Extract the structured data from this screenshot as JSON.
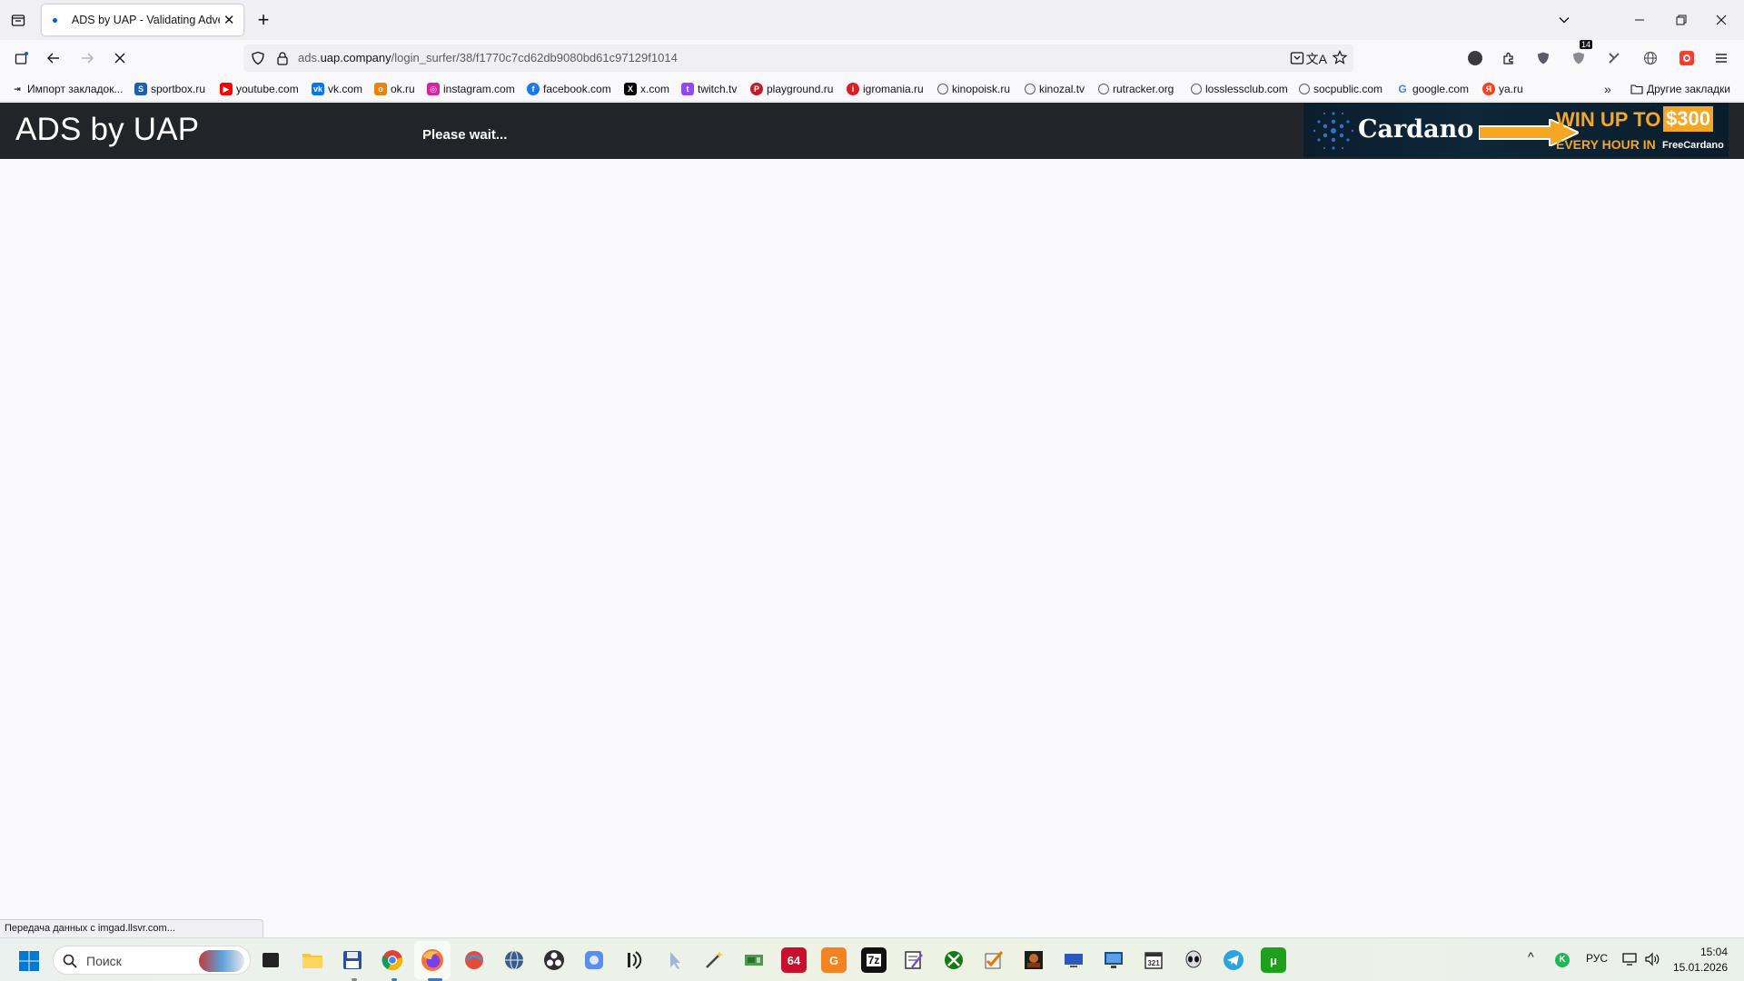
{
  "browser": {
    "tab": {
      "title": "ADS by UAP - Validating Advert"
    },
    "url": {
      "domain": "ads.uap.company",
      "path": "/login_surfer/38/f1770c7cd62db9080bd61c97129f1014",
      "prefix": "ads.",
      "host": "uap.company"
    },
    "extension_badge": "14",
    "bookmarks": [
      {
        "label": "Импорт закладок...",
        "color": "#5b5b66"
      },
      {
        "label": "sportbox.ru",
        "color": "#1a5fb4"
      },
      {
        "label": "youtube.com",
        "color": "#ff0000"
      },
      {
        "label": "vk.com",
        "color": "#0077ff"
      },
      {
        "label": "ok.ru",
        "color": "#ee8208"
      },
      {
        "label": "instagram.com",
        "color": "#d6249f"
      },
      {
        "label": "facebook.com",
        "color": "#1877f2"
      },
      {
        "label": "x.com",
        "color": "#000000"
      },
      {
        "label": "twitch.tv",
        "color": "#9146ff"
      },
      {
        "label": "playground.ru",
        "color": "#c01c28"
      },
      {
        "label": "igromania.ru",
        "color": "#e01b24"
      },
      {
        "label": "kinopoisk.ru",
        "color": "#5b5b66"
      },
      {
        "label": "kinozal.tv",
        "color": "#5b5b66"
      },
      {
        "label": "rutracker.org",
        "color": "#5b5b66"
      },
      {
        "label": "losslessclub.com",
        "color": "#5b5b66"
      },
      {
        "label": "socpublic.com",
        "color": "#5b5b66"
      },
      {
        "label": "google.com",
        "color": "#4285f4"
      },
      {
        "label": "ya.ru",
        "color": "#fc3f1d"
      }
    ],
    "other_bookmarks": "Другие закладки",
    "status_text": "Передача данных с imgad.llsvr.com..."
  },
  "page": {
    "brand": "ADS by UAP",
    "message": "Please wait...",
    "banner": {
      "coin": "Cardano",
      "line1": "WIN UP TO",
      "prize": "$300",
      "line2": "EVERY HOUR IN",
      "brand": "FreeCardano"
    }
  },
  "taskbar": {
    "search_placeholder": "Поиск",
    "apps": [
      "task-view",
      "file-explorer",
      "save-app",
      "chrome",
      "firefox",
      "app-red",
      "app-globe",
      "obs",
      "app-blue",
      "audio-app",
      "app-cursor",
      "wand-app",
      "gpu-app",
      "aida64",
      "app-orange",
      "7zip",
      "notepad-app",
      "xbox",
      "checklist-app",
      "image-app",
      "monitor-app",
      "remote-app",
      "calendar-app",
      "alien-app",
      "telegram",
      "utorrent"
    ],
    "app_64_label": "64",
    "app_7z_label": "7z",
    "lang": "РУС",
    "time": "15:04",
    "date": "15.01.2026"
  }
}
